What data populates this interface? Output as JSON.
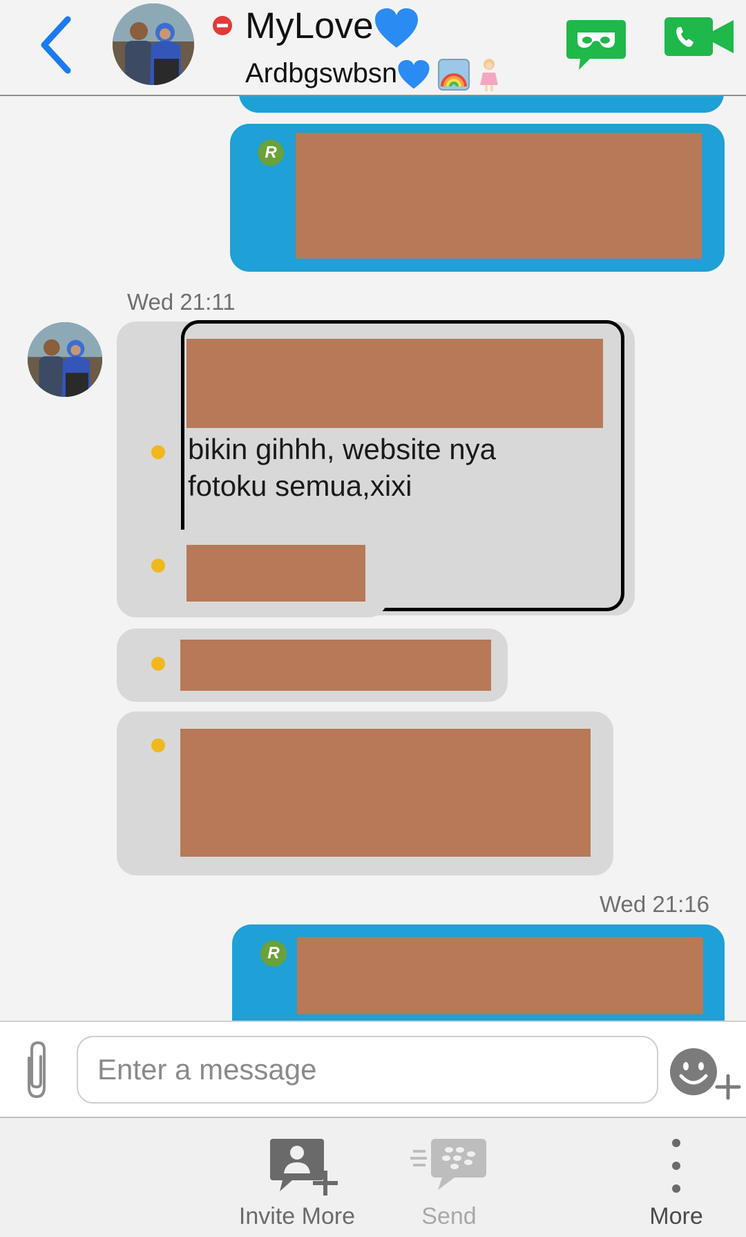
{
  "header": {
    "back_label": "back",
    "contact_name": "MyLove",
    "status_text": "Ardbgswbsn",
    "colors": {
      "accent_blue": "#1a7bf0",
      "call_green": "#1fb84a",
      "busy_red": "#e23a3a",
      "heart_blue": "#2a8bf2"
    },
    "icons": [
      "chevron-left-icon",
      "busy-status-icon",
      "blue-heart-icon",
      "rainbow-icon",
      "girl-icon",
      "voice-call-icon",
      "video-call-icon"
    ]
  },
  "chat": {
    "timestamps": [
      "Wed 21:11",
      "Wed 21:16"
    ],
    "sender_badge": "R",
    "highlighted_message": {
      "line1": "bikin gihhh, website nya",
      "line2": "fotoku semua,xixi"
    },
    "colors": {
      "outgoing_bubble": "#1fa0d6",
      "incoming_bubble": "#d8d8d8",
      "redaction": "#b77957",
      "unread_dot": "#f0b81c",
      "badge": "#6aa13a"
    }
  },
  "composer": {
    "placeholder": "Enter a message",
    "value": "",
    "icons": [
      "paperclip-icon",
      "emoji-add-icon"
    ]
  },
  "toolbar": {
    "invite_more_label": "Invite More",
    "send_label": "Send",
    "more_label": "More",
    "icons": [
      "invite-more-icon",
      "send-bbm-icon",
      "more-vertical-icon"
    ]
  }
}
